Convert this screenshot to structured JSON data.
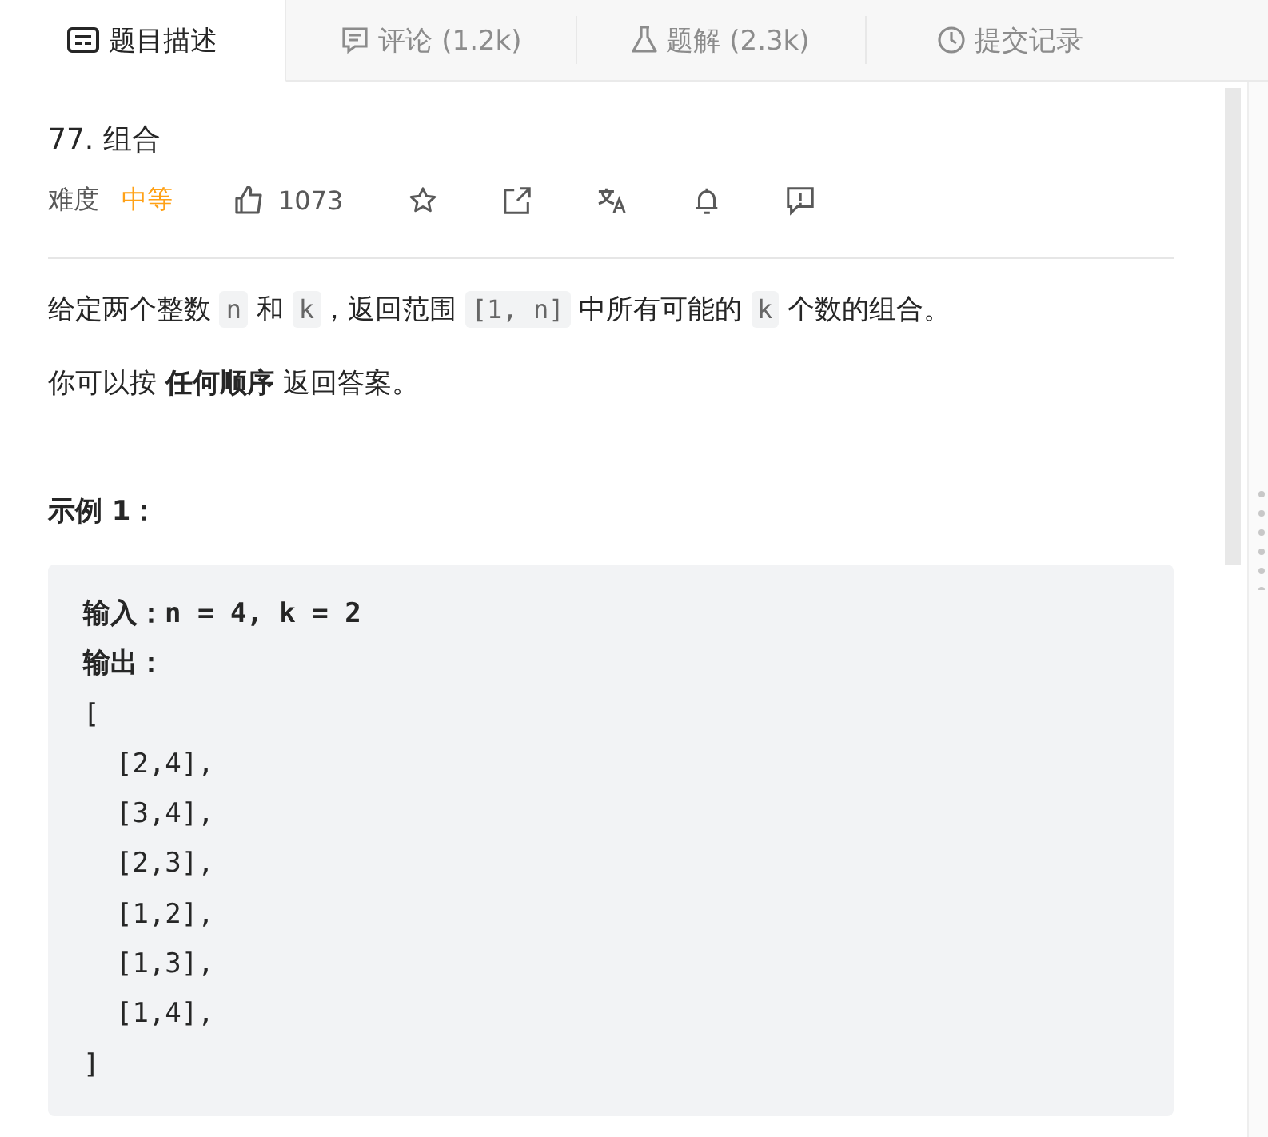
{
  "tabs": [
    {
      "label": "题目描述",
      "selected": true
    },
    {
      "label": "评论 (1.2k)",
      "selected": false
    },
    {
      "label": "题解 (2.3k)",
      "selected": false
    },
    {
      "label": "提交记录",
      "selected": false
    }
  ],
  "problem": {
    "title": "77. 组合",
    "difficulty_label": "难度",
    "difficulty": "中等",
    "likes": "1073"
  },
  "statement": [
    [
      {
        "kind": "text",
        "text": "给定两个整数 "
      },
      {
        "kind": "code",
        "text": "n"
      },
      {
        "kind": "text",
        "text": " 和 "
      },
      {
        "kind": "code",
        "text": "k"
      },
      {
        "kind": "text",
        "text": "，返回范围 "
      },
      {
        "kind": "code",
        "text": "[1, n]"
      },
      {
        "kind": "text",
        "text": " 中所有可能的 "
      },
      {
        "kind": "code",
        "text": "k"
      },
      {
        "kind": "text",
        "text": " 个数的组合。"
      }
    ],
    [
      {
        "kind": "text",
        "text": "你可以按 **任何顺序** 返回答案。"
      }
    ]
  ],
  "example": {
    "title": "示例 1：",
    "lines": [
      "输入：n = 4, k = 2",
      "输出：",
      "[",
      "  [2,4],",
      "  [3,4],",
      "  [2,3],",
      "  [1,2],",
      "  [1,3],",
      "  [1,4],",
      "]"
    ]
  }
}
